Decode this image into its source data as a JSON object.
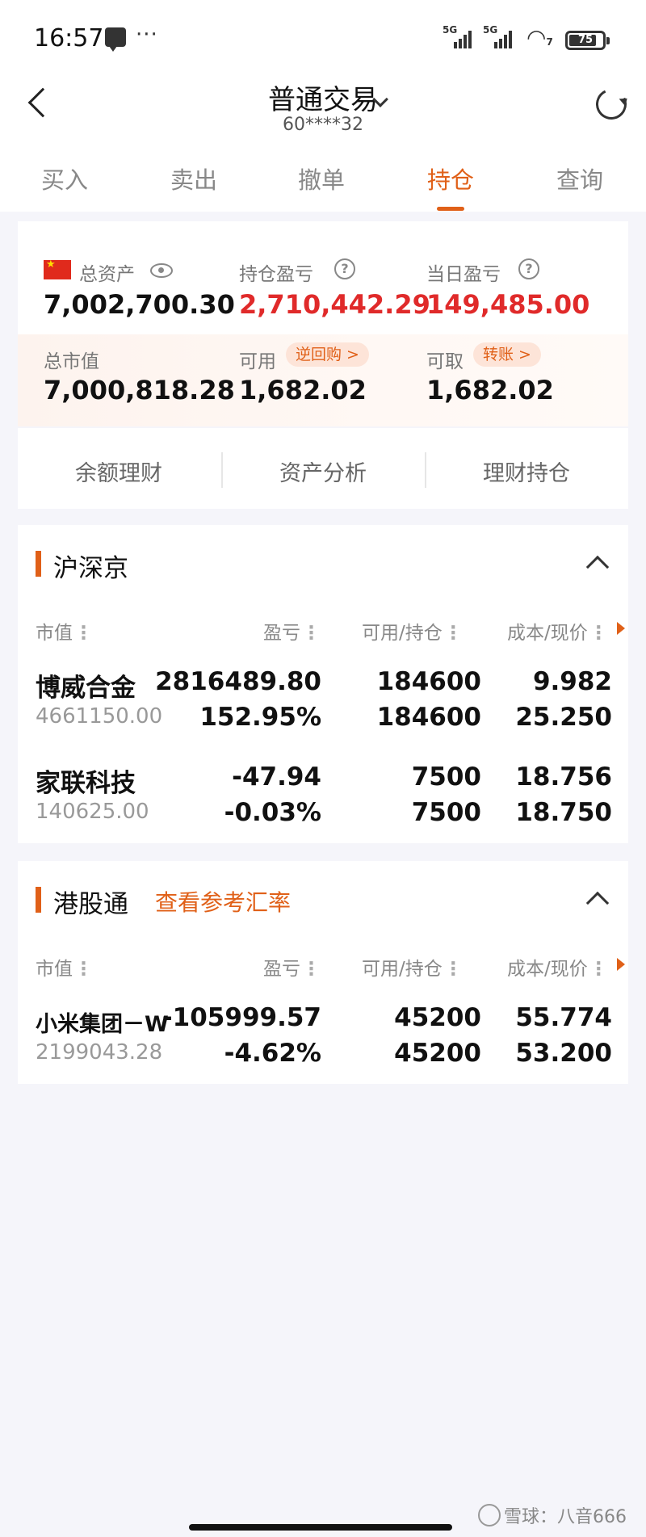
{
  "status_bar": {
    "time": "16:57",
    "dots": "···",
    "signal1": "5G",
    "signal2": "5G",
    "wifi": "7",
    "battery": "75"
  },
  "header": {
    "title": "普通交易",
    "account": "60****32"
  },
  "tabs": [
    "买入",
    "卖出",
    "撤单",
    "持仓",
    "查询"
  ],
  "summary": {
    "total_assets_label": "总资产",
    "total_assets": "7,002,700.30",
    "holding_pnl_label": "持仓盈亏",
    "holding_pnl": "2,710,442.29",
    "daily_pnl_label": "当日盈亏",
    "daily_pnl": "149,485.00",
    "market_value_label": "总市值",
    "market_value": "7,000,818.28",
    "available_label": "可用",
    "available": "1,682.02",
    "reverse_repo": "逆回购 >",
    "withdrawable_label": "可取",
    "withdrawable": "1,682.02",
    "transfer": "转账 >"
  },
  "quick_links": [
    "余额理财",
    "资产分析",
    "理财持仓"
  ],
  "columns": {
    "market_value": "市值",
    "pnl": "盈亏",
    "avail_hold": "可用/持仓",
    "cost_price": "成本/现价"
  },
  "section_a": {
    "title": "沪深京",
    "rows": [
      {
        "name": "博威合金",
        "market_value": "4661150.00",
        "pnl": "2816489.80",
        "pnl_pct": "152.95%",
        "available": "184600",
        "holding": "184600",
        "cost": "9.982",
        "price": "25.250"
      },
      {
        "name": "家联科技",
        "market_value": "140625.00",
        "pnl": "-47.94",
        "pnl_pct": "-0.03%",
        "available": "7500",
        "holding": "7500",
        "cost": "18.756",
        "price": "18.750"
      }
    ]
  },
  "section_b": {
    "title": "港股通",
    "link": "查看参考汇率",
    "rows": [
      {
        "name": "小米集团－W",
        "market_value": "2199043.28",
        "pnl": "-105999.57",
        "pnl_pct": "-4.62%",
        "available": "45200",
        "holding": "45200",
        "cost": "55.774",
        "price": "53.200"
      }
    ]
  },
  "watermark": "雪球：八音666",
  "colors": {
    "accent": "#e06018",
    "up": "#e02a2a",
    "down": "#1f9d5c"
  }
}
